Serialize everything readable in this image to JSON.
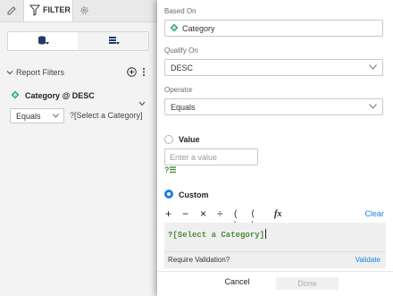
{
  "toolbar": {
    "filter_tab": "FILTER"
  },
  "report_filters": {
    "title": "Report Filters",
    "condition": {
      "name": "Category @ DESC",
      "operator": "Equals",
      "value": "?[Select a Category]"
    }
  },
  "dialog": {
    "based_on": {
      "label": "Based On",
      "value": "Category"
    },
    "qualify_on": {
      "label": "Qualify On",
      "value": "DESC"
    },
    "operator": {
      "label": "Operator",
      "value": "Equals"
    },
    "value_option": {
      "label": "Value",
      "placeholder": "Enter a value",
      "prompt_mark": "?☰"
    },
    "custom_option": {
      "label": "Custom",
      "selected": true
    },
    "expression_toolbar": {
      "fx": "fx",
      "clear": "Clear"
    },
    "expression": "?[Select a Category]",
    "validation": {
      "label": "Require Validation?",
      "link": "Validate"
    },
    "buttons": {
      "cancel": "Cancel",
      "done": "Done"
    }
  },
  "colors": {
    "accent": "#1c7fe0",
    "attribute_green": "#3aa776",
    "prompt_green": "#4d8a3a"
  }
}
